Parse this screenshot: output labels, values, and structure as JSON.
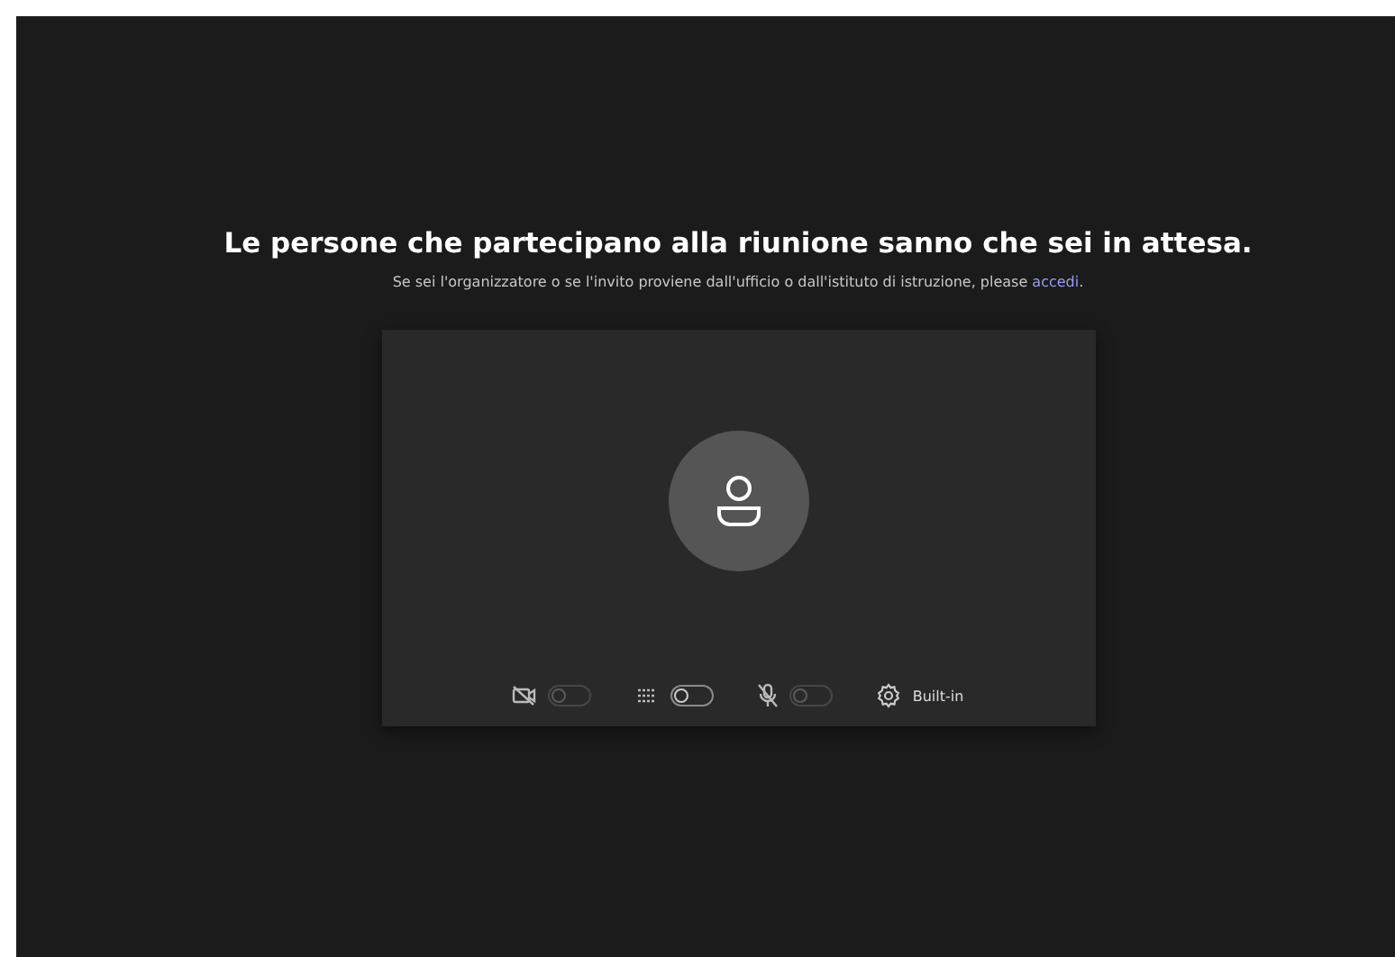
{
  "heading": "Le persone che partecipano alla riunione sanno che sei in attesa.",
  "subtitle": {
    "text": "Se sei l'organizzatore o se l'invito proviene dall'ufficio o dall'istituto di istruzione, please ",
    "link": "accedi",
    "end": "."
  },
  "controls": [
    {
      "kind": "camera",
      "on": false,
      "disabled": true
    },
    {
      "kind": "background",
      "on": false,
      "disabled": false
    },
    {
      "kind": "mic",
      "on": false,
      "disabled": true
    },
    {
      "kind": "device",
      "label": "Built-in"
    }
  ]
}
